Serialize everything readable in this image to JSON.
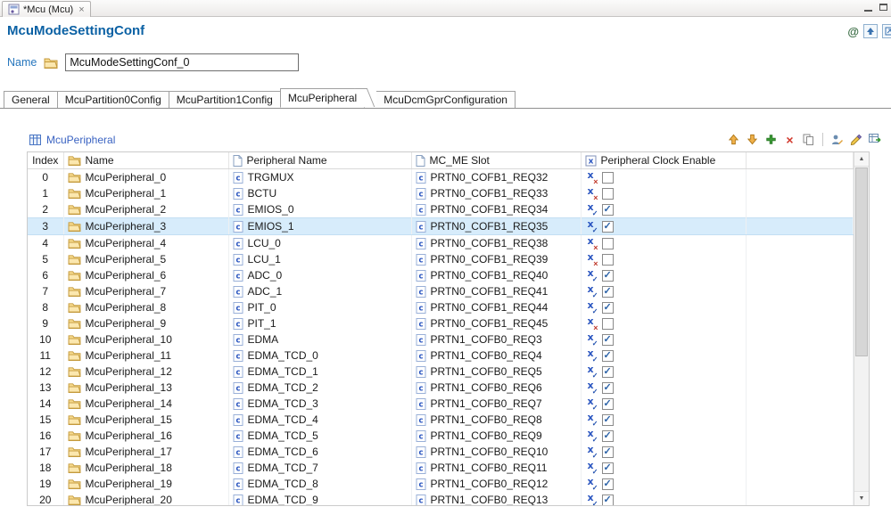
{
  "editor": {
    "tab_title": "*Mcu (Mcu)"
  },
  "header": {
    "title": "McuModeSettingConf"
  },
  "name_field": {
    "label": "Name",
    "value": "McuModeSettingConf_0"
  },
  "tabs": {
    "items": [
      {
        "label": "General"
      },
      {
        "label": "McuPartition0Config"
      },
      {
        "label": "McuPartition1Config"
      },
      {
        "label": "McuPeripheral"
      },
      {
        "label": "McuDcmGprConfiguration"
      }
    ],
    "active": "McuPeripheral"
  },
  "section": {
    "caption": "McuPeripheral"
  },
  "toolbar": {
    "icons": [
      "move-up",
      "move-down",
      "add",
      "remove",
      "copy",
      "rename",
      "edit",
      "export-table"
    ]
  },
  "table": {
    "columns": {
      "index": "Index",
      "name": "Name",
      "peripheral": "Peripheral Name",
      "slot": "MC_ME Slot",
      "clock": "Peripheral Clock Enable"
    },
    "selected_index": 3,
    "rows": [
      {
        "index": 0,
        "name": "McuPeripheral_0",
        "peripheral": "TRGMUX",
        "slot": "PRTN0_COFB1_REQ32",
        "enabled": false
      },
      {
        "index": 1,
        "name": "McuPeripheral_1",
        "peripheral": "BCTU",
        "slot": "PRTN0_COFB1_REQ33",
        "enabled": false
      },
      {
        "index": 2,
        "name": "McuPeripheral_2",
        "peripheral": "EMIOS_0",
        "slot": "PRTN0_COFB1_REQ34",
        "enabled": true
      },
      {
        "index": 3,
        "name": "McuPeripheral_3",
        "peripheral": "EMIOS_1",
        "slot": "PRTN0_COFB1_REQ35",
        "enabled": true
      },
      {
        "index": 4,
        "name": "McuPeripheral_4",
        "peripheral": "LCU_0",
        "slot": "PRTN0_COFB1_REQ38",
        "enabled": false
      },
      {
        "index": 5,
        "name": "McuPeripheral_5",
        "peripheral": "LCU_1",
        "slot": "PRTN0_COFB1_REQ39",
        "enabled": false
      },
      {
        "index": 6,
        "name": "McuPeripheral_6",
        "peripheral": "ADC_0",
        "slot": "PRTN0_COFB1_REQ40",
        "enabled": true
      },
      {
        "index": 7,
        "name": "McuPeripheral_7",
        "peripheral": "ADC_1",
        "slot": "PRTN0_COFB1_REQ41",
        "enabled": true
      },
      {
        "index": 8,
        "name": "McuPeripheral_8",
        "peripheral": "PIT_0",
        "slot": "PRTN0_COFB1_REQ44",
        "enabled": true
      },
      {
        "index": 9,
        "name": "McuPeripheral_9",
        "peripheral": "PIT_1",
        "slot": "PRTN0_COFB1_REQ45",
        "enabled": false
      },
      {
        "index": 10,
        "name": "McuPeripheral_10",
        "peripheral": "EDMA",
        "slot": "PRTN1_COFB0_REQ3",
        "enabled": true
      },
      {
        "index": 11,
        "name": "McuPeripheral_11",
        "peripheral": "EDMA_TCD_0",
        "slot": "PRTN1_COFB0_REQ4",
        "enabled": true
      },
      {
        "index": 12,
        "name": "McuPeripheral_12",
        "peripheral": "EDMA_TCD_1",
        "slot": "PRTN1_COFB0_REQ5",
        "enabled": true
      },
      {
        "index": 13,
        "name": "McuPeripheral_13",
        "peripheral": "EDMA_TCD_2",
        "slot": "PRTN1_COFB0_REQ6",
        "enabled": true
      },
      {
        "index": 14,
        "name": "McuPeripheral_14",
        "peripheral": "EDMA_TCD_3",
        "slot": "PRTN1_COFB0_REQ7",
        "enabled": true
      },
      {
        "index": 15,
        "name": "McuPeripheral_15",
        "peripheral": "EDMA_TCD_4",
        "slot": "PRTN1_COFB0_REQ8",
        "enabled": true
      },
      {
        "index": 16,
        "name": "McuPeripheral_16",
        "peripheral": "EDMA_TCD_5",
        "slot": "PRTN1_COFB0_REQ9",
        "enabled": true
      },
      {
        "index": 17,
        "name": "McuPeripheral_17",
        "peripheral": "EDMA_TCD_6",
        "slot": "PRTN1_COFB0_REQ10",
        "enabled": true
      },
      {
        "index": 18,
        "name": "McuPeripheral_18",
        "peripheral": "EDMA_TCD_7",
        "slot": "PRTN1_COFB0_REQ11",
        "enabled": true
      },
      {
        "index": 19,
        "name": "McuPeripheral_19",
        "peripheral": "EDMA_TCD_8",
        "slot": "PRTN1_COFB0_REQ12",
        "enabled": true
      },
      {
        "index": 20,
        "name": "McuPeripheral_20",
        "peripheral": "EDMA_TCD_9",
        "slot": "PRTN1_COFB0_REQ13",
        "enabled": true
      }
    ]
  },
  "icons": {
    "close": "×",
    "at": "@",
    "scroll_up": "▲",
    "scroll_down": "▼",
    "remove": "×"
  },
  "colors": {
    "title_blue": "#0b61a4",
    "link_blue": "#3a63c2",
    "selected_row": "#d7ecfb"
  }
}
